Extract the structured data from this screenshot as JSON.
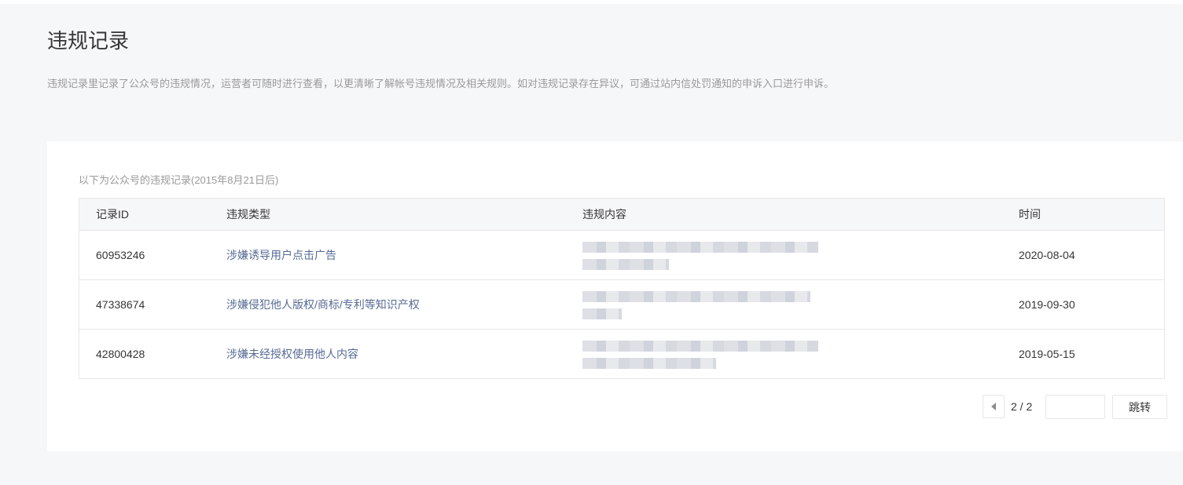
{
  "page": {
    "title": "违规记录",
    "description": "违规记录里记录了公众号的违规情况，运营者可随时进行查看，以更清晰了解帐号违规情况及相关规则。如对违规记录存在异议，可通过站内信处罚通知的申诉入口进行申诉。"
  },
  "table": {
    "caption": "以下为公众号的违规记录(2015年8月21日后)",
    "columns": {
      "id": "记录ID",
      "type": "违规类型",
      "content": "违规内容",
      "time": "时间"
    },
    "rows": [
      {
        "id": "60953246",
        "type": "涉嫌诱导用户点击广告",
        "time": "2020-08-04"
      },
      {
        "id": "47338674",
        "type": "涉嫌侵犯他人版权/商标/专利等知识产权",
        "time": "2019-09-30"
      },
      {
        "id": "42800428",
        "type": "涉嫌未经授权使用他人内容",
        "time": "2019-05-15"
      }
    ]
  },
  "pagination": {
    "current": "2 / 2",
    "input_value": "",
    "jump_label": "跳转"
  },
  "colors": {
    "page_background": "#f6f7f9",
    "link_text": "#576b95",
    "border": "#e7e7eb"
  }
}
